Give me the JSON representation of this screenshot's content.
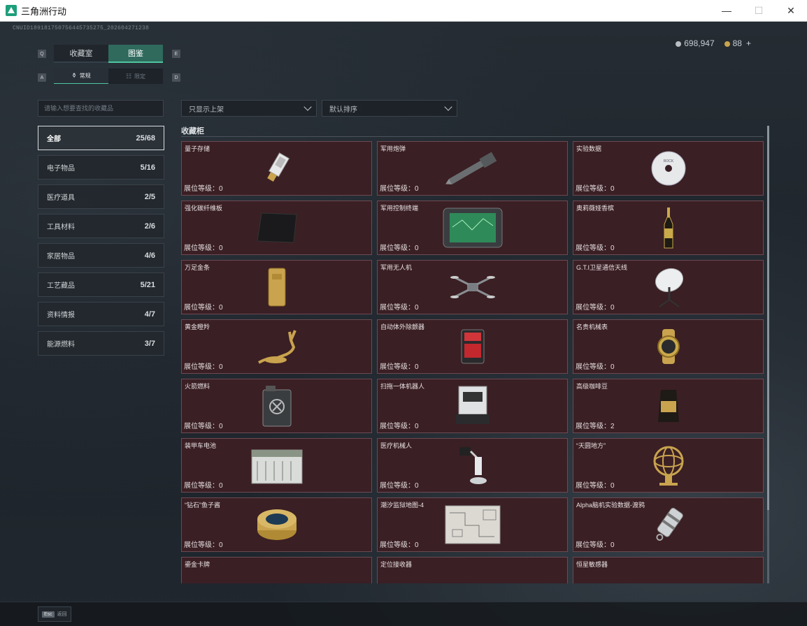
{
  "window": {
    "title": "三角洲行动",
    "minimize_glyph": "—",
    "maximize_glyph": "☐",
    "close_glyph": "✕"
  },
  "header": {
    "uid": "CNUID189181750756445735275_202604271238",
    "silver": "698,947",
    "gold": "88",
    "plus": "+"
  },
  "tabs": {
    "key_left": "Q",
    "key_right": "E",
    "items": [
      {
        "label": "收藏室"
      },
      {
        "label": "图鉴"
      }
    ],
    "active_index": 1
  },
  "subtabs": {
    "key_left": "A",
    "key_right": "D",
    "items": [
      {
        "label": "常规",
        "icon": "⚱"
      },
      {
        "label": "限定",
        "icon": "☷"
      }
    ],
    "active_index": 0
  },
  "search": {
    "placeholder": "请输入想要查找的收藏品",
    "value": ""
  },
  "categories": [
    {
      "name": "全部",
      "count": "25/68"
    },
    {
      "name": "电子物品",
      "count": "5/16"
    },
    {
      "name": "医疗道具",
      "count": "2/5"
    },
    {
      "name": "工具材料",
      "count": "2/6"
    },
    {
      "name": "家居物品",
      "count": "4/6"
    },
    {
      "name": "工艺藏品",
      "count": "5/21"
    },
    {
      "name": "资料情报",
      "count": "4/7"
    },
    {
      "name": "能源燃料",
      "count": "3/7"
    }
  ],
  "filters": {
    "shelf_filter": "只显示上架",
    "sort": "默认排序"
  },
  "cabinet": {
    "title": "收藏柜",
    "level_label": "展位等级："
  },
  "items": [
    {
      "name": "量子存储",
      "level": "0",
      "icon": "usb-drive-icon"
    },
    {
      "name": "军用炮弹",
      "level": "0",
      "icon": "artillery-shell-icon"
    },
    {
      "name": "实验数据",
      "level": "0",
      "icon": "data-disc-icon"
    },
    {
      "name": "强化碳纤维板",
      "level": "0",
      "icon": "carbon-plate-icon"
    },
    {
      "name": "军用控制终端",
      "level": "0",
      "icon": "control-terminal-icon"
    },
    {
      "name": "奥莉薇娅香槟",
      "level": "0",
      "icon": "champagne-bottle-icon"
    },
    {
      "name": "万足金条",
      "level": "0",
      "icon": "gold-bar-icon"
    },
    {
      "name": "军用无人机",
      "level": "0",
      "icon": "drone-icon"
    },
    {
      "name": "G.T.I卫星通信天线",
      "level": "0",
      "icon": "satellite-dish-icon"
    },
    {
      "name": "黄金瞪羚",
      "level": "0",
      "icon": "gold-gazelle-icon"
    },
    {
      "name": "自动体外除颤器",
      "level": "0",
      "icon": "defibrillator-icon"
    },
    {
      "name": "名贵机械表",
      "level": "0",
      "icon": "watch-icon"
    },
    {
      "name": "火箭燃料",
      "level": "0",
      "icon": "fuel-canister-icon"
    },
    {
      "name": "扫拖一体机器人",
      "level": "0",
      "icon": "cleaning-robot-icon"
    },
    {
      "name": "高级咖啡豆",
      "level": "2",
      "icon": "coffee-bag-icon"
    },
    {
      "name": "装甲车电池",
      "level": "0",
      "icon": "vehicle-battery-icon"
    },
    {
      "name": "医疗机械人",
      "level": "0",
      "icon": "medical-robot-icon"
    },
    {
      "name": "“天圆地方”",
      "level": "0",
      "icon": "armillary-sphere-icon"
    },
    {
      "name": "“钻石”鱼子酱",
      "level": "0",
      "icon": "caviar-tin-icon"
    },
    {
      "name": "潮汐监狱地图-4",
      "level": "0",
      "icon": "map-sheet-icon"
    },
    {
      "name": "Alpha脑机实验数据-渡鸦",
      "level": "0",
      "icon": "data-cylinder-icon"
    },
    {
      "name": "鎏金卡牌",
      "level": "",
      "icon": "gold-card-icon"
    },
    {
      "name": "定位接收器",
      "level": "",
      "icon": "receiver-icon"
    },
    {
      "name": "恒星敏感器",
      "level": "",
      "icon": "star-sensor-icon"
    }
  ],
  "bottom": {
    "esc_key": "Esc",
    "esc_label": "返回"
  }
}
